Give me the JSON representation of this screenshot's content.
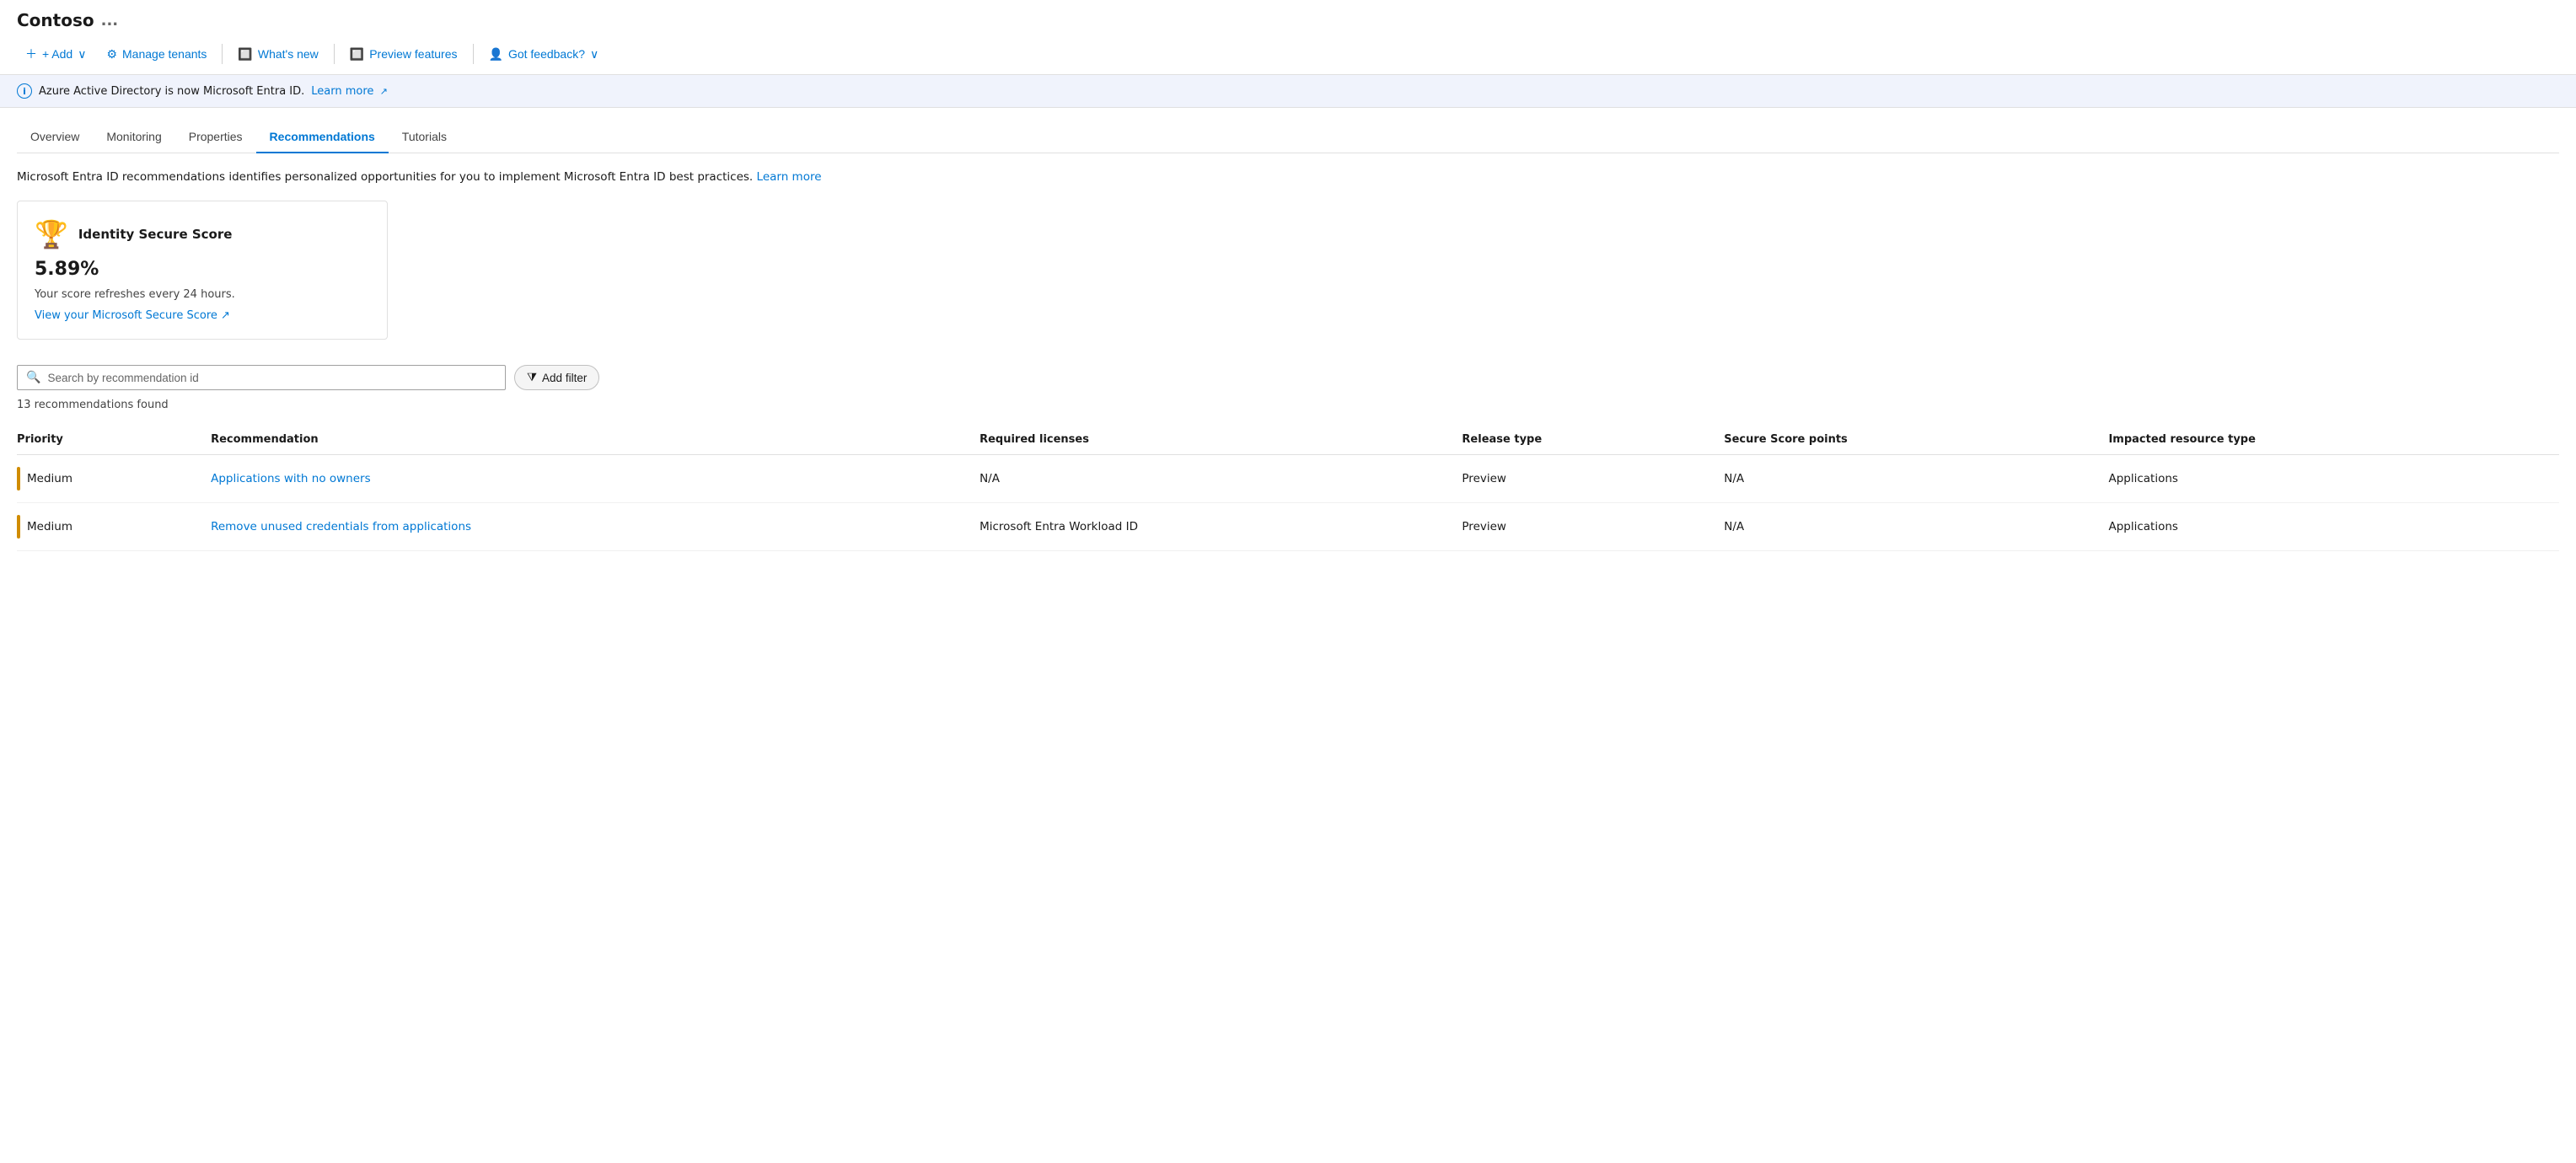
{
  "org": {
    "name": "Contoso",
    "dots": "..."
  },
  "toolbar": {
    "add_label": "+ Add",
    "add_chevron": "∨",
    "manage_tenants_label": "Manage tenants",
    "whats_new_label": "What's new",
    "preview_features_label": "Preview features",
    "got_feedback_label": "Got feedback?",
    "got_feedback_chevron": "∨"
  },
  "info_banner": {
    "text": "Azure Active Directory is now Microsoft Entra ID.",
    "learn_more": "Learn more"
  },
  "tabs": [
    {
      "label": "Overview",
      "active": false
    },
    {
      "label": "Monitoring",
      "active": false
    },
    {
      "label": "Properties",
      "active": false
    },
    {
      "label": "Recommendations",
      "active": true
    },
    {
      "label": "Tutorials",
      "active": false
    }
  ],
  "page": {
    "description": "Microsoft Entra ID recommendations identifies personalized opportunities for you to implement Microsoft Entra ID best practices.",
    "learn_more": "Learn more"
  },
  "score_card": {
    "title": "Identity Secure Score",
    "value": "5.89%",
    "refresh_text": "Your score refreshes every 24 hours.",
    "link_text": "View your Microsoft Secure Score ↗"
  },
  "search": {
    "placeholder": "Search by recommendation id"
  },
  "filter_button": "Add filter",
  "results": {
    "count": "13 recommendations found"
  },
  "table": {
    "columns": [
      "Priority",
      "Recommendation",
      "Required licenses",
      "Release type",
      "Secure Score points",
      "Impacted resource type"
    ],
    "rows": [
      {
        "priority": "Medium",
        "recommendation": "Applications with no owners",
        "required_licenses": "N/A",
        "release_type": "Preview",
        "secure_score_points": "N/A",
        "impacted_resource_type": "Applications"
      },
      {
        "priority": "Medium",
        "recommendation": "Remove unused credentials from applications",
        "required_licenses": "Microsoft Entra Workload ID",
        "release_type": "Preview",
        "secure_score_points": "N/A",
        "impacted_resource_type": "Applications"
      }
    ]
  }
}
